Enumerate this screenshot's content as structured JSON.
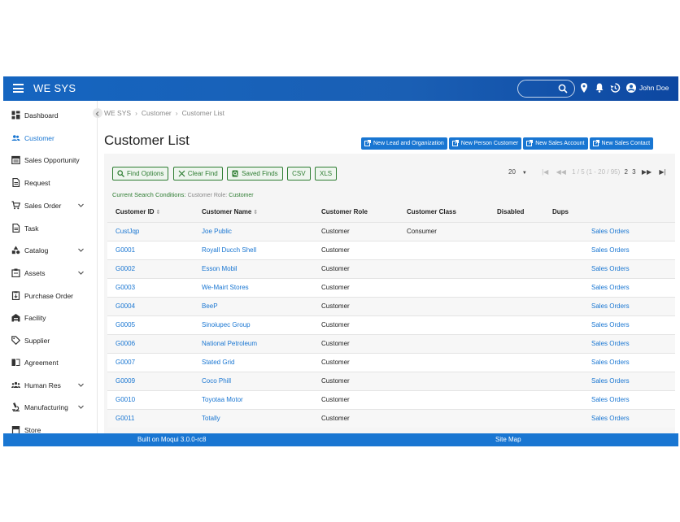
{
  "app": {
    "title": "WE SYS",
    "user": "John Doe"
  },
  "sidebar": {
    "items": [
      {
        "label": "Dashboard",
        "icon": "dashboard-icon",
        "active": false,
        "expandable": false
      },
      {
        "label": "Customer",
        "icon": "people-icon",
        "active": true,
        "expandable": false
      },
      {
        "label": "Sales Opportunity",
        "icon": "calendar-icon",
        "active": false,
        "expandable": false
      },
      {
        "label": "Request",
        "icon": "document-icon",
        "active": false,
        "expandable": false
      },
      {
        "label": "Sales Order",
        "icon": "cart-icon",
        "active": false,
        "expandable": true
      },
      {
        "label": "Task",
        "icon": "document-icon",
        "active": false,
        "expandable": false
      },
      {
        "label": "Catalog",
        "icon": "shapes-icon",
        "active": false,
        "expandable": true
      },
      {
        "label": "Assets",
        "icon": "assets-icon",
        "active": false,
        "expandable": true
      },
      {
        "label": "Purchase Order",
        "icon": "purchase-icon",
        "active": false,
        "expandable": false
      },
      {
        "label": "Facility",
        "icon": "warehouse-icon",
        "active": false,
        "expandable": false
      },
      {
        "label": "Supplier",
        "icon": "tag-icon",
        "active": false,
        "expandable": false
      },
      {
        "label": "Agreement",
        "icon": "book-icon",
        "active": false,
        "expandable": false
      },
      {
        "label": "Human Res",
        "icon": "group-icon",
        "active": false,
        "expandable": true
      },
      {
        "label": "Manufacturing",
        "icon": "microscope-icon",
        "active": false,
        "expandable": true
      },
      {
        "label": "Store",
        "icon": "store-icon",
        "active": false,
        "expandable": false
      }
    ]
  },
  "breadcrumb": {
    "items": [
      "WE SYS",
      "Customer",
      "Customer List"
    ]
  },
  "page": {
    "title": "Customer List"
  },
  "actions": {
    "new_lead": "New Lead and Organization",
    "new_person": "New Person Customer",
    "new_account": "New Sales Account",
    "new_contact": "New Sales Contact"
  },
  "find": {
    "find_options": "Find Options",
    "clear_find": "Clear Find",
    "saved_finds": "Saved Finds",
    "csv": "CSV",
    "xls": "XLS"
  },
  "pager": {
    "page_size": "20",
    "range": "1 / 5 (1 - 20 / 95)",
    "page2": "2",
    "page3": "3"
  },
  "conditions": {
    "label": "Current Search Conditions:",
    "role_label": "Customer Role:",
    "role_value": "Customer"
  },
  "table": {
    "headers": [
      "Customer ID",
      "Customer Name",
      "Customer Role",
      "Customer Class",
      "Disabled",
      "Dups",
      ""
    ],
    "rows": [
      {
        "id": "CustJqp",
        "name": "Joe Public",
        "role": "Customer",
        "class": "Consumer",
        "disabled": "",
        "dups": "",
        "link": "Sales Orders"
      },
      {
        "id": "G0001",
        "name": "Royall Ducch Shell",
        "role": "Customer",
        "class": "",
        "disabled": "",
        "dups": "",
        "link": "Sales Orders"
      },
      {
        "id": "G0002",
        "name": "Esson Mobil",
        "role": "Customer",
        "class": "",
        "disabled": "",
        "dups": "",
        "link": "Sales Orders"
      },
      {
        "id": "G0003",
        "name": "We-Mairt Stores",
        "role": "Customer",
        "class": "",
        "disabled": "",
        "dups": "",
        "link": "Sales Orders"
      },
      {
        "id": "G0004",
        "name": "BeeP",
        "role": "Customer",
        "class": "",
        "disabled": "",
        "dups": "",
        "link": "Sales Orders"
      },
      {
        "id": "G0005",
        "name": "Sinoiupec Group",
        "role": "Customer",
        "class": "",
        "disabled": "",
        "dups": "",
        "link": "Sales Orders"
      },
      {
        "id": "G0006",
        "name": "National Petroleum",
        "role": "Customer",
        "class": "",
        "disabled": "",
        "dups": "",
        "link": "Sales Orders"
      },
      {
        "id": "G0007",
        "name": "Stated Grid",
        "role": "Customer",
        "class": "",
        "disabled": "",
        "dups": "",
        "link": "Sales Orders"
      },
      {
        "id": "G0009",
        "name": "Coco Phill",
        "role": "Customer",
        "class": "",
        "disabled": "",
        "dups": "",
        "link": "Sales Orders"
      },
      {
        "id": "G0010",
        "name": "Toyotaa Motor",
        "role": "Customer",
        "class": "",
        "disabled": "",
        "dups": "",
        "link": "Sales Orders"
      },
      {
        "id": "G0011",
        "name": "Totally",
        "role": "Customer",
        "class": "",
        "disabled": "",
        "dups": "",
        "link": "Sales Orders"
      }
    ]
  },
  "footer": {
    "built": "Built on Moqui 3.0.0-rc8",
    "site_map": "Site Map"
  },
  "colors": {
    "primary": "#1976d2",
    "topbar": "#1a5fb4",
    "find_green": "#2e7d32"
  }
}
